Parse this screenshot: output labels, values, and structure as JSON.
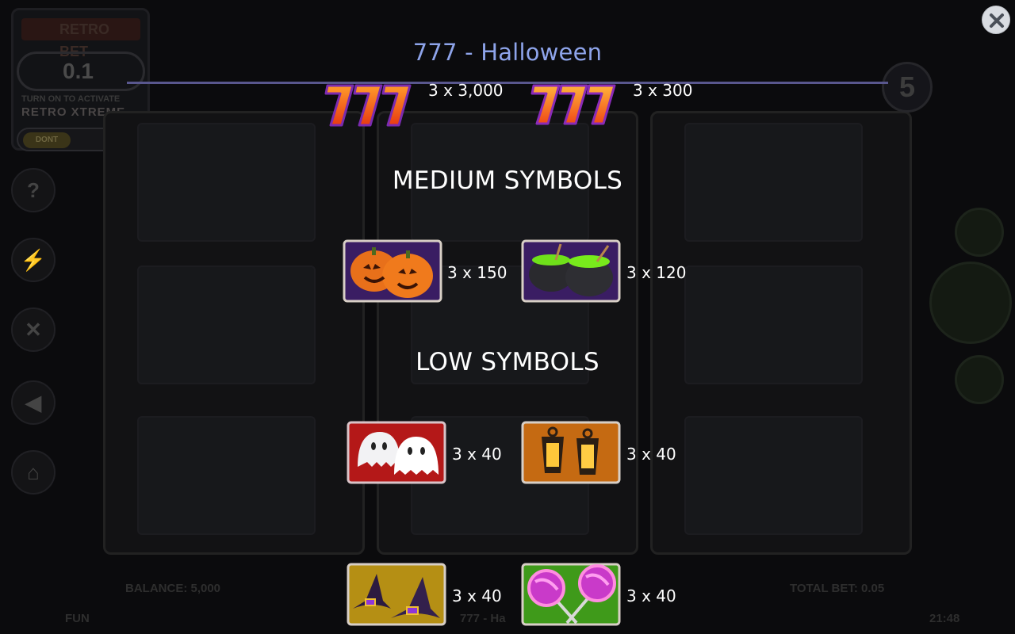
{
  "title": "777 - Halloween",
  "close_icon": "close-icon",
  "sections": {
    "high": {
      "label": "",
      "symbols": [
        {
          "name": "red-777-symbol",
          "payout": "3 x 3,000"
        },
        {
          "name": "orange-777-symbol",
          "payout": "3 x 300"
        }
      ]
    },
    "medium": {
      "label": "MEDIUM SYMBOLS",
      "symbols": [
        {
          "name": "pumpkins-symbol",
          "payout": "3 x 150"
        },
        {
          "name": "cauldrons-symbol",
          "payout": "3 x 120"
        }
      ]
    },
    "low": {
      "label": "LOW SYMBOLS",
      "symbols": [
        {
          "name": "ghosts-symbol",
          "payout": "3 x 40"
        },
        {
          "name": "lanterns-symbol",
          "payout": "3 x 40"
        },
        {
          "name": "witch-hats-symbol",
          "payout": "3 x 40"
        },
        {
          "name": "lollipops-symbol",
          "payout": "3 x 40"
        }
      ]
    }
  },
  "background": {
    "bet_value": "0.1",
    "jackpot_logo": "RETRO BET",
    "turn_on_text": "TURN ON TO ACTIVATE",
    "xtreme_text": "RETRO XTREME",
    "toggle_label": "DONT",
    "lines": "5",
    "balance": "BALANCE: 5,000",
    "total_bet": "TOTAL BET: 0.05",
    "mode": "FUN",
    "game_name": "777 - Ha",
    "time": "21:48"
  },
  "colors": {
    "title": "#8ea4ea",
    "title_line": "#59578e",
    "background": "#0b0b0d",
    "text": "#ffffff"
  }
}
